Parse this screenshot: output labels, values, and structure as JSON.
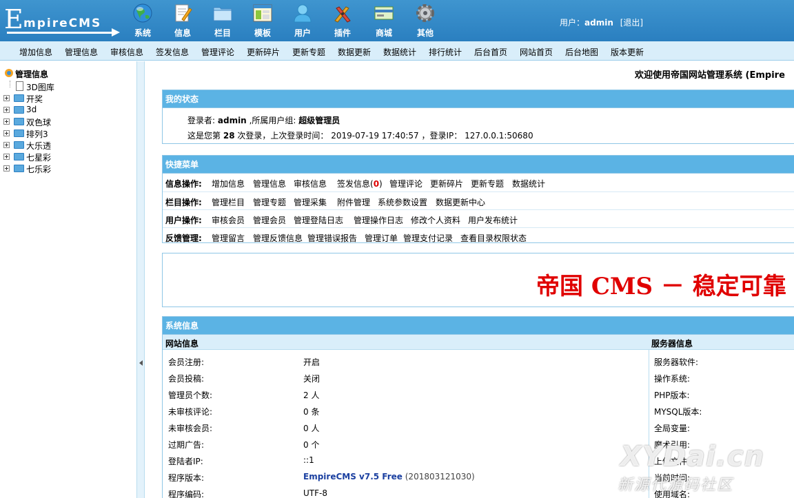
{
  "logo": {
    "big": "E",
    "small": "mpireCMS"
  },
  "topnav": [
    {
      "label": "系统",
      "icon": "globe-icon"
    },
    {
      "label": "信息",
      "icon": "document-edit-icon"
    },
    {
      "label": "栏目",
      "icon": "folder-icon"
    },
    {
      "label": "模板",
      "icon": "window-template-icon"
    },
    {
      "label": "用户",
      "icon": "user-icon"
    },
    {
      "label": "插件",
      "icon": "tools-icon"
    },
    {
      "label": "商城",
      "icon": "card-icon"
    },
    {
      "label": "其他",
      "icon": "gear-icon"
    }
  ],
  "user": {
    "prefix": "用户：",
    "name": "admin",
    "logout": "[退出]"
  },
  "submenu": [
    "增加信息",
    "管理信息",
    "审核信息",
    "签发信息",
    "管理评论",
    "更新碎片",
    "更新专题",
    "数据更新",
    "数据统计",
    "排行统计",
    "后台首页",
    "网站首页",
    "后台地图",
    "版本更新"
  ],
  "tree": {
    "root": "管理信息",
    "first": "3D图库",
    "items": [
      "开奖",
      "3d",
      "双色球",
      "排列3",
      "大乐透",
      "七星彩",
      "七乐彩"
    ]
  },
  "welcome": "欢迎使用帝国网站管理系统 (Empire",
  "status": {
    "title": "我的状态",
    "login_label": "登录者:",
    "login_user": "admin",
    "group_label": ",所属用户组:",
    "group": "超级管理员",
    "count_prefix": "这是您第",
    "count": "28",
    "count_suffix": "次登录，上次登录时间：",
    "last_time": "2019-07-19 17:40:57",
    "ip_label": "，登录IP：",
    "ip": "127.0.0.1:50680"
  },
  "quick": {
    "title": "快捷菜单",
    "rows": [
      {
        "label": "信息操作:",
        "items": [
          "增加信息",
          "管理信息",
          "审核信息",
          "签发信息(",
          "管理评论",
          "更新碎片",
          "更新专题",
          "数据统计"
        ],
        "pending": "0"
      },
      {
        "label": "栏目操作:",
        "items": [
          "管理栏目",
          "管理专题",
          "管理采集",
          "附件管理",
          "系统参数设置",
          "数据更新中心"
        ]
      },
      {
        "label": "用户操作:",
        "items": [
          "审核会员",
          "管理会员",
          "管理登陆日志",
          "管理操作日志",
          "修改个人资料",
          "用户发布统计"
        ]
      },
      {
        "label": "反馈管理:",
        "items": [
          "管理留言",
          "管理反馈信息",
          "管理错误报告",
          "管理订单",
          "管理支付记录",
          "查看目录权限状态"
        ]
      }
    ]
  },
  "banner": {
    "slogan": "帝国 CMS － 稳定可靠"
  },
  "sysinfo": {
    "title": "系统信息",
    "left_header": "网站信息",
    "right_header": "服务器信息",
    "rows": [
      {
        "k": "会员注册:",
        "v": "开启"
      },
      {
        "k": "会员投稿:",
        "v": "关闭"
      },
      {
        "k": "管理员个数:",
        "v": "2 人"
      },
      {
        "k": "未审核评论:",
        "v": "0 条"
      },
      {
        "k": "未审核会员:",
        "v": "0 人"
      },
      {
        "k": "过期广告:",
        "v": "0 个"
      },
      {
        "k": "登陆者IP:",
        "v": "::1"
      },
      {
        "k": "程序版本:",
        "v": "EmpireCMS v7.5 Free",
        "build": "(201803121030)"
      },
      {
        "k": "程序编码:",
        "v": "UTF-8"
      }
    ],
    "server_rows": [
      "服务器软件:",
      "操作系统:",
      "PHP版本:",
      "MYSQL版本:",
      "全局变量:",
      "魔术引用:",
      "上传文件:",
      "当前时间:",
      "使用域名:"
    ]
  },
  "watermark": {
    "line1": "XYDai.cn",
    "line2": "新源代源码社区"
  }
}
